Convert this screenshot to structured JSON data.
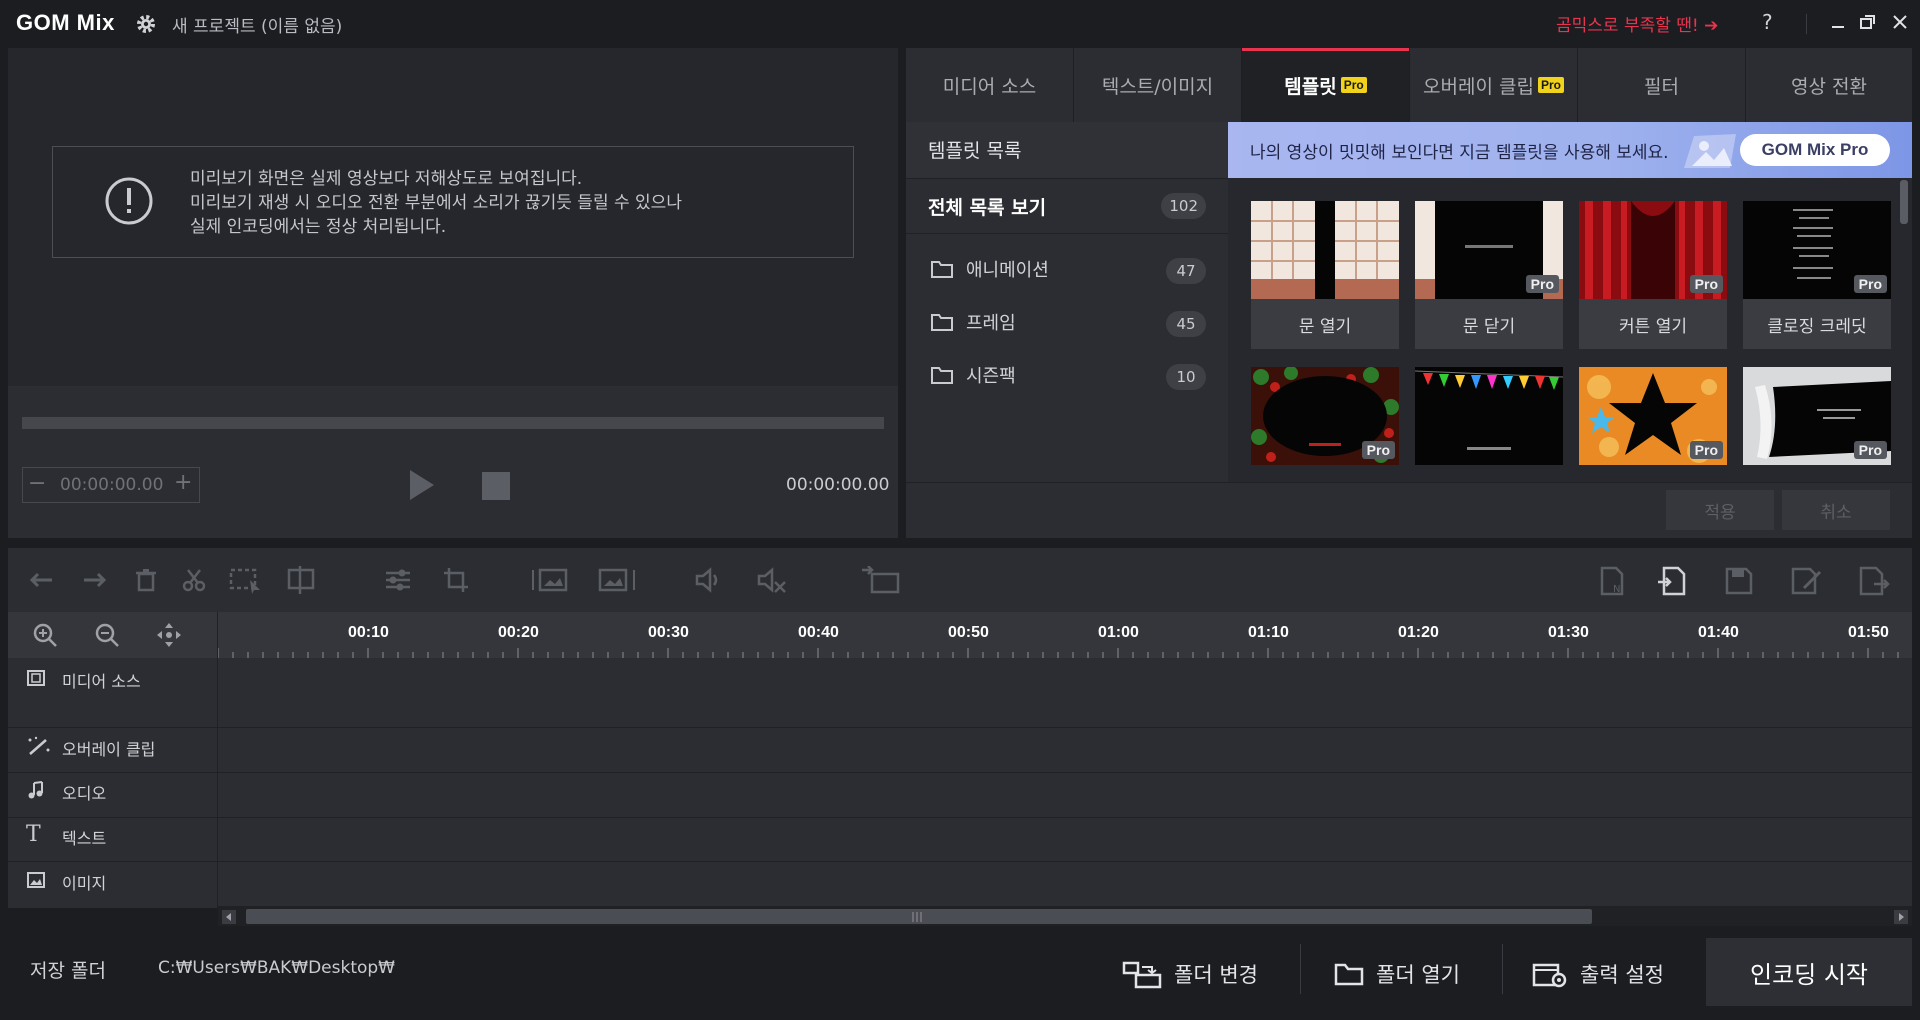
{
  "titlebar": {
    "logo": "GOM Mix",
    "project_title": "새 프로젝트 (이름 없음)",
    "promo_text": "곰믹스로 부족할 땐! ➔",
    "help_label": "?"
  },
  "preview": {
    "notice_lines": [
      "미리보기 화면은 실제 영상보다 저해상도로 보여집니다.",
      "미리보기 재생 시 오디오 전환 부분에서 소리가 끊기듯 들릴 수 있으나",
      "실제 인코딩에서는 정상 처리됩니다."
    ],
    "timecode": "00:00:00.00",
    "total_time": "00:00:00.00"
  },
  "tabs": [
    {
      "label": "미디어 소스",
      "pro": false
    },
    {
      "label": "텍스트/이미지",
      "pro": false
    },
    {
      "label": "템플릿",
      "pro": true,
      "active": true
    },
    {
      "label": "오버레이 클립",
      "pro": true
    },
    {
      "label": "필터",
      "pro": false
    },
    {
      "label": "영상 전환",
      "pro": false
    }
  ],
  "pro_badge": "Pro",
  "categories": {
    "header": "템플릿 목록",
    "all": {
      "label": "전체 목록 보기",
      "count": "102"
    },
    "folders": [
      {
        "label": "애니메이션",
        "count": "47"
      },
      {
        "label": "프레임",
        "count": "45"
      },
      {
        "label": "시즌팩",
        "count": "10"
      }
    ]
  },
  "banner": {
    "text": "나의 영상이 밋밋해 보인다면 지금 템플릿을 사용해 보세요.",
    "button": "GOM Mix Pro"
  },
  "templates": [
    {
      "label": "문 열기",
      "pro": false
    },
    {
      "label": "문 닫기",
      "pro": true
    },
    {
      "label": "커튼 열기",
      "pro": true
    },
    {
      "label": "클로징 크레딧",
      "pro": true
    },
    {
      "label": "",
      "pro": true
    },
    {
      "label": "",
      "pro": false
    },
    {
      "label": "",
      "pro": true
    },
    {
      "label": "",
      "pro": true
    }
  ],
  "actions": {
    "apply": "적용",
    "cancel": "취소"
  },
  "timeline": {
    "ticks": [
      "00:10",
      "00:20",
      "00:30",
      "00:40",
      "00:50",
      "01:00",
      "01:10",
      "01:20",
      "01:30",
      "01:40",
      "01:50"
    ],
    "tracks": [
      "미디어 소스",
      "오버레이 클립",
      "오디오",
      "텍스트",
      "이미지"
    ]
  },
  "bottom": {
    "save_label": "저장 폴더",
    "save_path": "C:₩Users₩BAK₩Desktop₩",
    "change_folder": "폴더 변경",
    "open_folder": "폴더 열기",
    "output_settings": "출력 설정",
    "encode": "인코딩 시작"
  },
  "colors": {
    "accent": "#e8344e",
    "pro": "#f2d31b",
    "banner": "#a9b6f0"
  }
}
